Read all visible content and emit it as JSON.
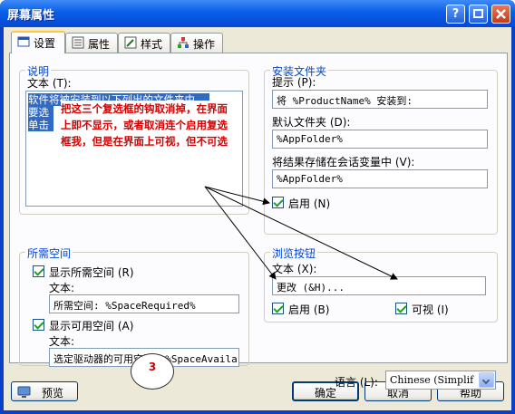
{
  "window": {
    "title": "屏幕属性",
    "colors": {
      "title_bar": "#0a5ee8",
      "dialog_face": "#ece9d8",
      "group_title": "#0046d5",
      "annotation": "#d40000",
      "selection": "#316ac5"
    }
  },
  "tabs": [
    {
      "label": "设置",
      "icon": "settings-window-icon"
    },
    {
      "label": "属性",
      "icon": "properties-list-icon"
    },
    {
      "label": "样式",
      "icon": "style-icon"
    },
    {
      "label": "操作",
      "icon": "actions-icon"
    }
  ],
  "description": {
    "title": "说明",
    "text_label": "文本 (T):",
    "text_lines": [
      "软件将被安装到以下列出的文件夹中。",
      "要选",
      "单击"
    ]
  },
  "annotation": {
    "lines": [
      "把这三个复选框的钩取消掉，在界面",
      "上即不显示，或者取消连个启用复选",
      "框我，但是在界面上可视，但不可选"
    ]
  },
  "install_folder": {
    "title": "安装文件夹",
    "prompt_label": "提示 (P):",
    "prompt_value": "将 %ProductName% 安装到:",
    "default_label": "默认文件夹 (D):",
    "default_value": "%AppFolder%",
    "store_label": "将结果存储在会话变量中 (V):",
    "store_value": "%AppFolder%",
    "enable_label": "启用 (N)"
  },
  "space": {
    "title": "所需空间",
    "show_required_label": "显示所需空间 (R)",
    "required_text_label": "文本:",
    "required_value": "所需空间: %SpaceRequired%",
    "show_available_label": "显示可用空间 (A)",
    "available_text_label": "文本:",
    "available_value": "选定驱动器的可用空间: %SpaceAvaila"
  },
  "browse": {
    "title": "浏览按钮",
    "text_label": "文本 (X):",
    "text_value": "更改 (&H)...",
    "enable_label": "启用 (B)",
    "visible_label": "可视 (I)"
  },
  "language": {
    "label": "语言 (L):",
    "value": "Chinese (Simplif"
  },
  "marker": {
    "number": "3"
  },
  "buttons": {
    "preview": "预览",
    "ok": "确定",
    "cancel": "取消",
    "help": "帮助"
  }
}
